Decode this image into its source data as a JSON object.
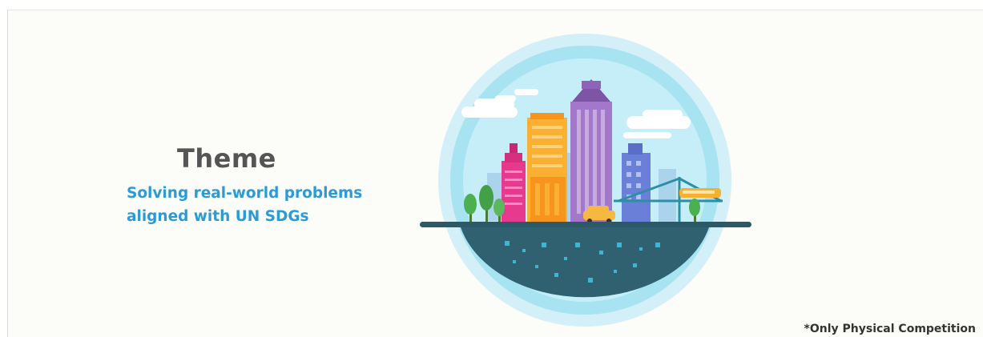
{
  "theme": {
    "title": "Theme",
    "subtitle_line1": "Solving real-world problems",
    "subtitle_line2": "aligned with UN SDGs"
  },
  "footnote": "*Only Physical Competition",
  "illustration": {
    "icon": "city-globe-illustration"
  },
  "colors": {
    "title": "#555555",
    "subtitle": "#2a9bd6",
    "background": "#fcfcf9",
    "globe_outer": "#c7ebf5",
    "globe_inner": "#8fdcee",
    "ground": "#2f6170"
  }
}
